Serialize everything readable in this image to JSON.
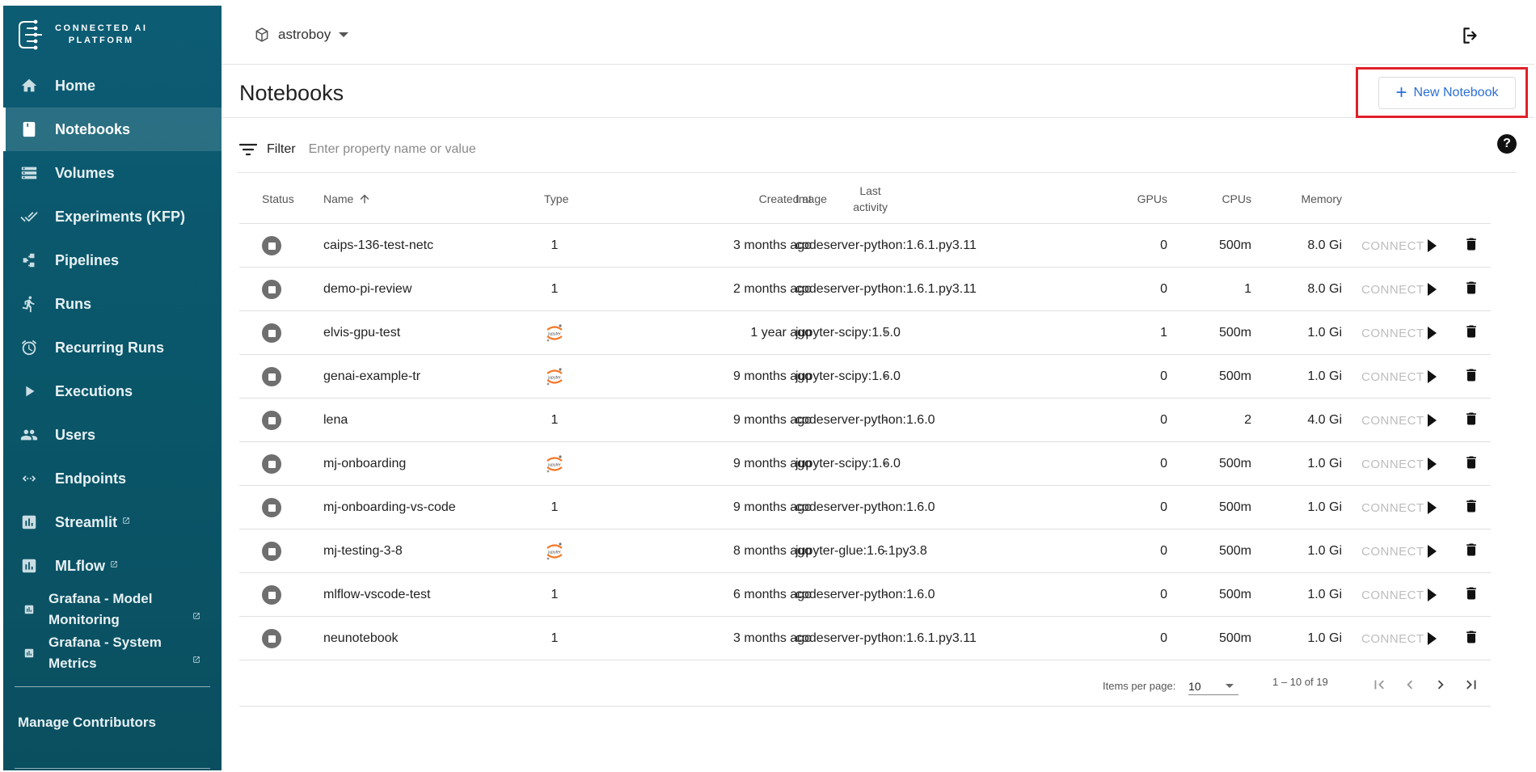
{
  "sidebar": {
    "brand_line1": "CONNECTED AI",
    "brand_line2": "PLATFORM",
    "items": [
      {
        "label": "Home",
        "icon": "home-icon"
      },
      {
        "label": "Notebooks",
        "icon": "notebook-icon",
        "active": true
      },
      {
        "label": "Volumes",
        "icon": "storage-icon"
      },
      {
        "label": "Experiments (KFP)",
        "icon": "done-all-icon"
      },
      {
        "label": "Pipelines",
        "icon": "pipeline-icon"
      },
      {
        "label": "Runs",
        "icon": "run-icon"
      },
      {
        "label": "Recurring Runs",
        "icon": "alarm-icon"
      },
      {
        "label": "Executions",
        "icon": "play-arrow-icon"
      },
      {
        "label": "Users",
        "icon": "people-icon"
      },
      {
        "label": "Endpoints",
        "icon": "code-arrows-icon"
      },
      {
        "label": "Streamlit",
        "icon": "bar-chart-icon",
        "external": true
      },
      {
        "label": "MLflow",
        "icon": "bar-chart-icon",
        "external": true
      },
      {
        "label_1": "Grafana - Model",
        "label_2": "Monitoring",
        "icon": "bar-chart-icon",
        "external": true
      },
      {
        "label_1": "Grafana - System",
        "label_2": "Metrics",
        "icon": "bar-chart-icon",
        "external": true
      }
    ],
    "manage_contributors": "Manage Contributors"
  },
  "header": {
    "namespace": "astroboy"
  },
  "page": {
    "title": "Notebooks",
    "new_button": "New Notebook",
    "filter_label": "Filter",
    "filter_placeholder": "Enter property name or value",
    "help": "?"
  },
  "table": {
    "columns": {
      "status": "Status",
      "name": "Name",
      "type": "Type",
      "created": "Created at",
      "last_activity_1": "Last",
      "last_activity_2": "activity",
      "image": "Image",
      "gpus": "GPUs",
      "cpus": "CPUs",
      "memory": "Memory"
    },
    "connect_label": "CONNECT",
    "rows": [
      {
        "name": "caips-136-test-netc",
        "type": "1",
        "created": "3 months ago",
        "last": "-",
        "image": "codeserver-python:1.6.1.py3.11",
        "gpus": "0",
        "cpus": "500m",
        "memory": "8.0 Gi"
      },
      {
        "name": "demo-pi-review",
        "type": "1",
        "created": "2 months ago",
        "last": "-",
        "image": "codeserver-python:1.6.1.py3.11",
        "gpus": "0",
        "cpus": "1",
        "memory": "8.0 Gi"
      },
      {
        "name": "elvis-gpu-test",
        "type": "jupyter",
        "created": "1 year ago",
        "last": "-",
        "image": "jupyter-scipy:1.5.0",
        "gpus": "1",
        "cpus": "500m",
        "memory": "1.0 Gi"
      },
      {
        "name": "genai-example-tr",
        "type": "jupyter",
        "created": "9 months ago",
        "last": "-",
        "image": "jupyter-scipy:1.6.0",
        "gpus": "0",
        "cpus": "500m",
        "memory": "1.0 Gi"
      },
      {
        "name": "lena",
        "type": "1",
        "created": "9 months ago",
        "last": "-",
        "image": "codeserver-python:1.6.0",
        "gpus": "0",
        "cpus": "2",
        "memory": "4.0 Gi"
      },
      {
        "name": "mj-onboarding",
        "type": "jupyter",
        "created": "9 months ago",
        "last": "-",
        "image": "jupyter-scipy:1.6.0",
        "gpus": "0",
        "cpus": "500m",
        "memory": "1.0 Gi"
      },
      {
        "name": "mj-onboarding-vs-code",
        "type": "1",
        "created": "9 months ago",
        "last": "-",
        "image": "codeserver-python:1.6.0",
        "gpus": "0",
        "cpus": "500m",
        "memory": "1.0 Gi"
      },
      {
        "name": "mj-testing-3-8",
        "type": "jupyter",
        "created": "8 months ago",
        "last": "-",
        "image": "jupyter-glue:1.6.1py3.8",
        "gpus": "0",
        "cpus": "500m",
        "memory": "1.0 Gi"
      },
      {
        "name": "mlflow-vscode-test",
        "type": "1",
        "created": "6 months ago",
        "last": "-",
        "image": "codeserver-python:1.6.0",
        "gpus": "0",
        "cpus": "500m",
        "memory": "1.0 Gi"
      },
      {
        "name": "neunotebook",
        "type": "1",
        "created": "3 months ago",
        "last": "-",
        "image": "codeserver-python:1.6.1.py3.11",
        "gpus": "0",
        "cpus": "500m",
        "memory": "1.0 Gi"
      }
    ]
  },
  "paginator": {
    "items_per_page_label": "Items per page:",
    "items_per_page": "10",
    "range": "1 – 10 of 19"
  },
  "colors": {
    "sidebar": "#0c5c74",
    "accent": "#2b6fd6",
    "highlight": "#e0202a"
  }
}
